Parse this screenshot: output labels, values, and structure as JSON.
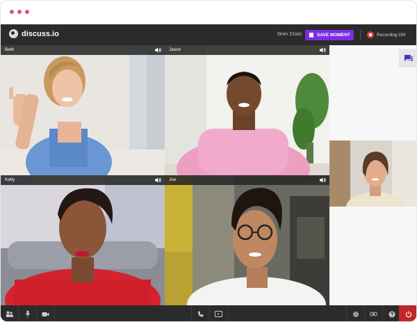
{
  "window": {
    "dot_color": "#e64c8c"
  },
  "app": {
    "name": "discuss.io",
    "timer": "0min 21sec",
    "save_moment_label": "SAVE MOMENT",
    "recording_label": "Recording ON",
    "accent": "#7a2de0",
    "record_color": "#e53935"
  },
  "participants": [
    {
      "name": "Beth",
      "audio_icon": "speaker-icon"
    },
    {
      "name": "Jason",
      "audio_icon": "speaker-icon"
    },
    {
      "name": "Kelly",
      "audio_icon": "speaker-icon"
    },
    {
      "name": "Joe",
      "audio_icon": "speaker-icon"
    }
  ],
  "sidebar": {
    "chat_icon": "chat-icon"
  },
  "toolbar": {
    "left": [
      "participants-icon",
      "microphone-icon",
      "camera-icon"
    ],
    "center": [
      "phone-icon",
      "screen-share-icon"
    ],
    "right": [
      "settings-icon",
      "link-icon",
      "help-icon",
      "power-icon"
    ],
    "end_color": "#c0262b"
  }
}
